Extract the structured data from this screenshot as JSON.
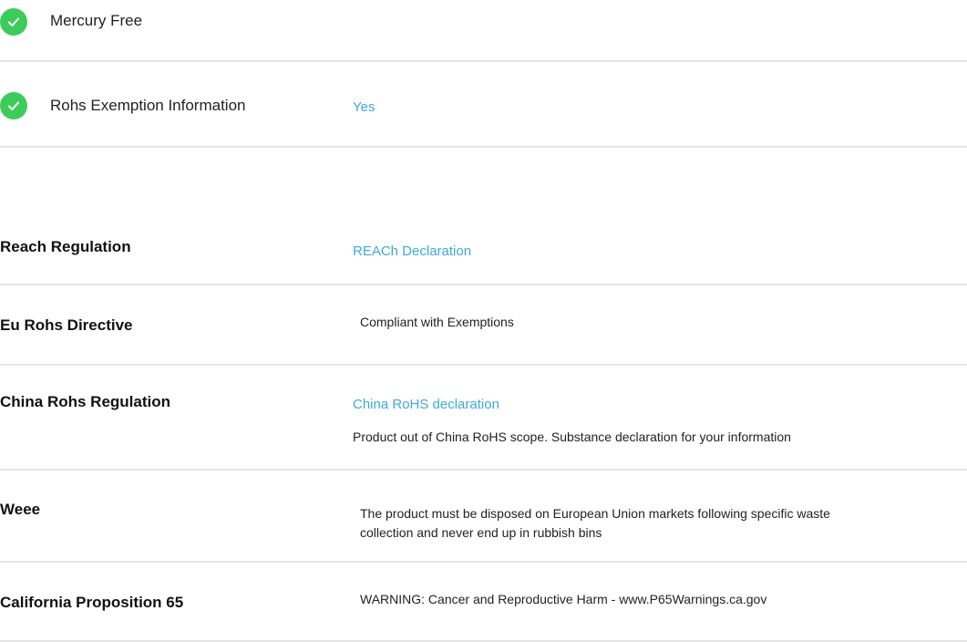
{
  "features": [
    {
      "label": "Mercury Free",
      "icon": "check-circle-icon"
    },
    {
      "label": "Rohs Exemption Information",
      "value": "Yes",
      "icon": "check-circle-icon"
    }
  ],
  "regulations": {
    "reach": {
      "label": "Reach Regulation",
      "link": "REACh Declaration"
    },
    "eu_rohs": {
      "label": "Eu Rohs Directive",
      "value": "Compliant with Exemptions"
    },
    "china_rohs": {
      "label": "China Rohs Regulation",
      "link": "China RoHS declaration",
      "note": "Product out of China RoHS scope. Substance declaration for your information"
    },
    "weee": {
      "label": "Weee",
      "value": "The product must be disposed on European Union markets following specific waste collection and never end up in rubbish bins"
    },
    "prop65": {
      "label": "California Proposition 65",
      "value": "WARNING: Cancer and Reproductive Harm - www.P65Warnings.ca.gov"
    }
  },
  "colors": {
    "check_green": "#3dcc5b",
    "link_blue": "#3fa9dc",
    "divider_gray": "#e6e6e6"
  }
}
